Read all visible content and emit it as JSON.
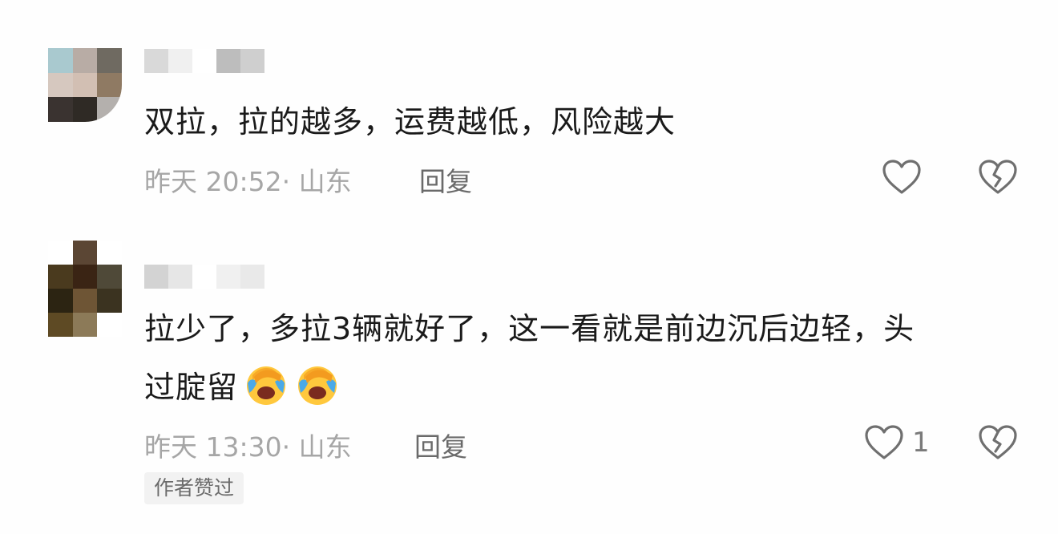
{
  "comments": [
    {
      "text": "双拉，拉的越多，运费越低，风险越大",
      "time": "昨天 20:52",
      "location": "山东",
      "reply_label": "回复",
      "like_count": "",
      "avatar_colors": [
        "#a9c9cf",
        "#b8aca5",
        "#6f6a61",
        "#d6c8bf",
        "#d2bfb3",
        "#8f7a63",
        "#3a3330",
        "#2f2a25",
        "#b4b0ad"
      ],
      "username_blocks": [
        "#d9d9d9",
        "#f0f0f0",
        "#ffffff",
        "#bdbdbd",
        "#cfcfcf"
      ]
    },
    {
      "text_line1": "拉少了，多拉3辆就好了，这一看就是前边沉后边轻，头",
      "text_line2": "过腚留",
      "emojis": [
        "facepalm-crying-emoji",
        "facepalm-crying-emoji"
      ],
      "time": "昨天 13:30",
      "location": "山东",
      "reply_label": "回复",
      "like_count": "1",
      "badge": "作者赞过",
      "avatar_colors": [
        "#ffffff",
        "#5b4634",
        "#ffffff",
        "#4a3a1e",
        "#3a2414",
        "#4f4938",
        "#2c2412",
        "#6e5535",
        "#3b3320",
        "#5e4a24",
        "#8c7a58",
        "#ffffff"
      ],
      "username_blocks": [
        "#d3d3d3",
        "#e6e6e6",
        "#ffffff",
        "#f0f0f0",
        "#e9e9e9"
      ]
    }
  ],
  "icons": {
    "like": "heart-outline-icon",
    "dislike": "broken-heart-icon"
  },
  "colors": {
    "text": "#1a1a1a",
    "meta": "#a6a6a6",
    "icon": "#6f6f6f",
    "badge_bg": "#f2f2f2"
  }
}
